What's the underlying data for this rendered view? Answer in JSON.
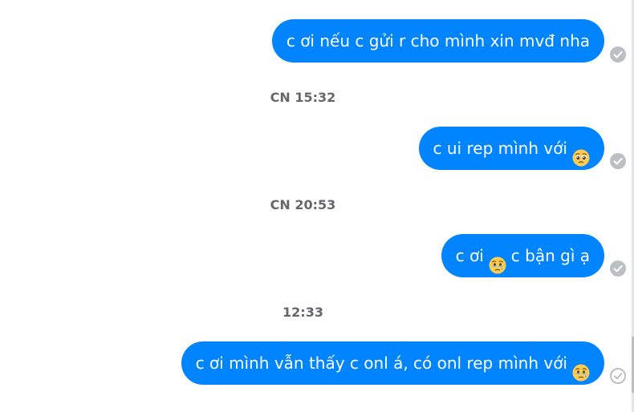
{
  "messages": [
    {
      "text": "c ơi nếu c gửi r cho mình xin mvđ nha",
      "status": "seen-check-icon"
    },
    {
      "text": "c ui rep mình với",
      "emoji": "pleading-face-icon",
      "status": "seen-check-icon"
    },
    {
      "text_before": "c ơi",
      "emoji": "holding-back-tears-face-icon",
      "text_after": "c bận gì ạ",
      "status": "seen-check-icon"
    },
    {
      "text": "c ơi mình vẫn thấy c onl á, có onl rep mình với",
      "emoji": "holding-back-tears-face-icon",
      "status": "sent-check-icon"
    }
  ],
  "timestamps": [
    "CN 15:32",
    "CN 20:53",
    "12:33"
  ],
  "colors": {
    "bubble": "#0084ff",
    "bubble_text": "#ffffff",
    "timestamp_text": "#65676b",
    "seen_icon": "#bcc0c4"
  }
}
